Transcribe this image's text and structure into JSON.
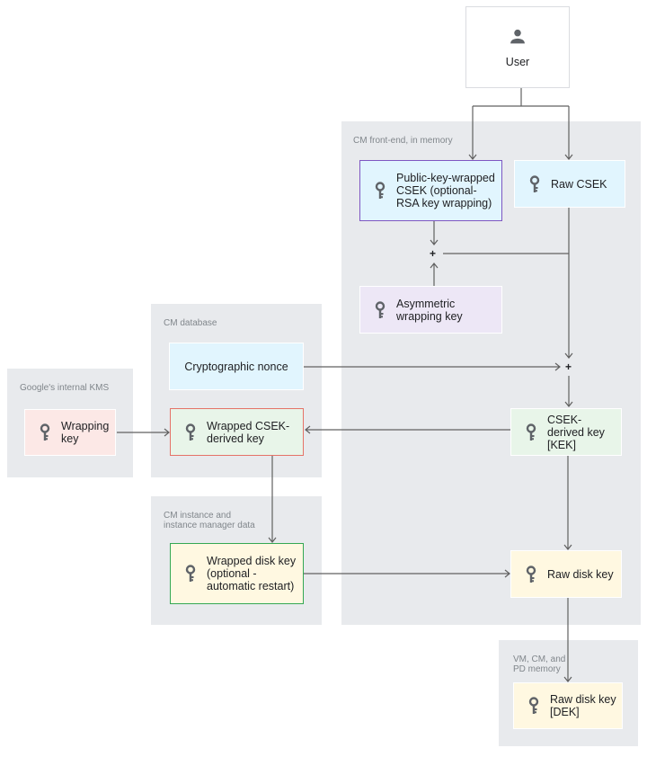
{
  "user": {
    "label": "User",
    "icon": "person-icon"
  },
  "groups": {
    "frontend": "CM front-end, in memory",
    "database": "CM database",
    "kms": "Google's internal KMS",
    "instance": "CM instance and instance manager data",
    "vm": "VM, CM, and PD memory"
  },
  "nodes": {
    "public_key_wrapped": "Public-key-wrapped CSEK (optional-RSA key wrapping)",
    "raw_csek": "Raw CSEK",
    "asymmetric": "Asymmetric wrapping key",
    "nonce": "Cryptographic nonce",
    "wrapped_csek_derived": "Wrapped CSEK-derived key",
    "wrapping_key": "Wrapping key",
    "csek_derived": "CSEK-derived key [KEK]",
    "wrapped_disk": "Wrapped disk key (optional - automatic restart)",
    "raw_disk": "Raw disk key",
    "raw_disk_dek": "Raw disk key [DEK]"
  },
  "operators": {
    "plus1": "+",
    "plus2": "+"
  },
  "colors": {
    "group_bg": "#e8eaed",
    "blue_fill": "#e1f5fe",
    "purple_fill": "#ede7f6",
    "purple_border": "#7e57c2",
    "green_fill": "#e8f5e9",
    "red_border": "#e57368",
    "pink_fill": "#fce8e6",
    "yellow_fill": "#fff8e1",
    "green_border": "#34a853",
    "line": "#616161"
  }
}
